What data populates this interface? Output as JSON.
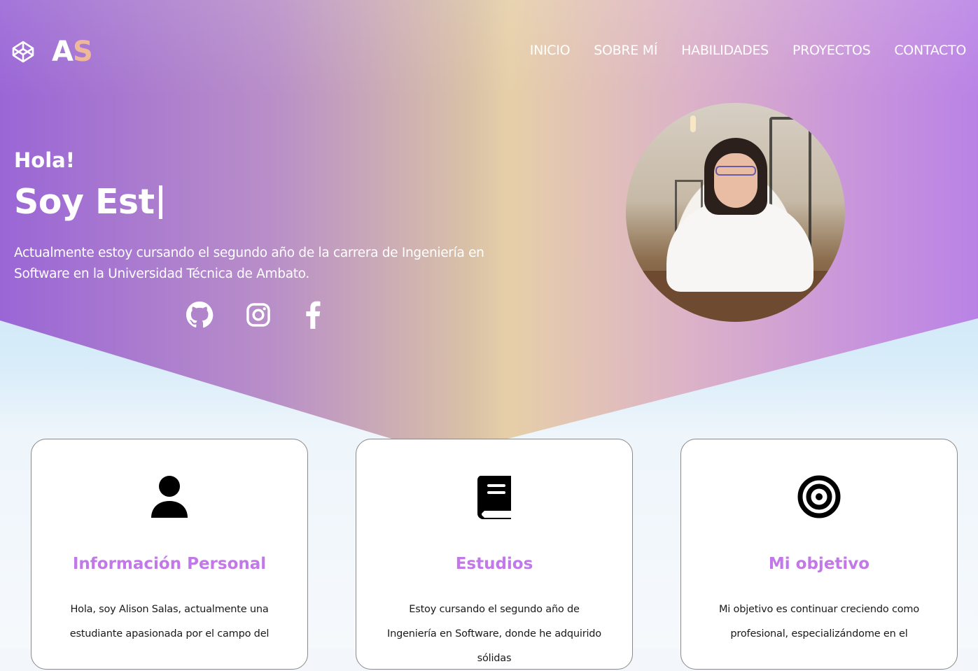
{
  "brand": {
    "first": "A",
    "second": "S",
    "logo_icon": "codepen-icon"
  },
  "nav": {
    "items": [
      "INICIO",
      "SOBRE MÍ",
      "HABILIDADES",
      "PROYECTOS",
      "CONTACTO"
    ]
  },
  "hero": {
    "greeting": "Hola!",
    "typed_text": "Soy Est",
    "intro": "Actualmente estoy cursando el segundo año de la carrera de Ingeniería en Software en la Universidad Técnica de Ambato.",
    "social": [
      "github-icon",
      "instagram-icon",
      "facebook-icon"
    ]
  },
  "cards": [
    {
      "icon": "user-icon",
      "title": "Información Personal",
      "text": "Hola, soy Alison Salas, actualmente una estudiante apasionada por el campo del"
    },
    {
      "icon": "book-icon",
      "title": "Estudios",
      "text": "Estoy cursando el segundo año de Ingeniería en Software, donde he adquirido sólidas"
    },
    {
      "icon": "target-icon",
      "title": "Mi objetivo",
      "text": "Mi objetivo es continuar creciendo como profesional, especializándome en el"
    }
  ],
  "colors": {
    "accent": "#c278e8",
    "brand_s": "#f0b89a"
  }
}
